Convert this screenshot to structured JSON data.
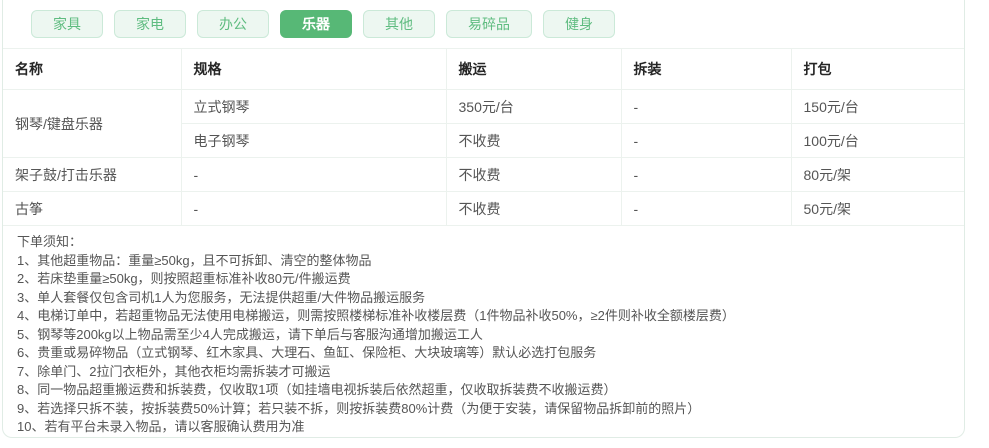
{
  "tabs": [
    {
      "label": "家具",
      "active": false
    },
    {
      "label": "家电",
      "active": false
    },
    {
      "label": "办公",
      "active": false
    },
    {
      "label": "乐器",
      "active": true
    },
    {
      "label": "其他",
      "active": false
    },
    {
      "label": "易碎品",
      "active": false
    },
    {
      "label": "健身",
      "active": false
    }
  ],
  "table": {
    "headers": [
      "名称",
      "规格",
      "搬运",
      "拆装",
      "打包"
    ],
    "groups": [
      {
        "name": "钢琴/键盘乐器",
        "rows": [
          {
            "spec": "立式钢琴",
            "moving": "350元/台",
            "disassembly": "-",
            "packing": "150元/台"
          },
          {
            "spec": "电子钢琴",
            "moving": "不收费",
            "disassembly": "-",
            "packing": "100元/台"
          }
        ]
      },
      {
        "name": "架子鼓/打击乐器",
        "rows": [
          {
            "spec": "-",
            "moving": "不收费",
            "disassembly": "-",
            "packing": "80元/架"
          }
        ]
      },
      {
        "name": "古筝",
        "rows": [
          {
            "spec": "-",
            "moving": "不收费",
            "disassembly": "-",
            "packing": "50元/架"
          }
        ]
      }
    ]
  },
  "notes": {
    "title": "下单须知：",
    "items": [
      "1、其他超重物品：重量≥50kg，且不可拆卸、清空的整体物品",
      "2、若床垫重量≥50kg，则按照超重标准补收80元/件搬运费",
      "3、单人套餐仅包含司机1人为您服务，无法提供超重/大件物品搬运服务",
      "4、电梯订单中，若超重物品无法使用电梯搬运，则需按照楼梯标准补收楼层费（1件物品补收50%，≥2件则补收全额楼层费）",
      "5、钢琴等200kg以上物品需至少4人完成搬运，请下单后与客服沟通增加搬运工人",
      "6、贵重或易碎物品（立式钢琴、红木家具、大理石、鱼缸、保险柜、大块玻璃等）默认必选打包服务",
      "7、除单门、2拉门衣柜外，其他衣柜均需拆装才可搬运",
      "8、同一物品超重搬运费和拆装费，仅收取1项（如挂墙电视拆装后依然超重，仅收取拆装费不收搬运费）",
      "9、若选择只拆不装，按拆装费50%计算；若只装不拆，则按拆装费80%计费（为便于安装，请保留物品拆卸前的照片）",
      "10、若有平台未录入物品，请以客服确认费用为准"
    ]
  },
  "colors": {
    "accent": "#57b876",
    "tab_bg": "#edf7f1",
    "tab_border": "#cbe9d8",
    "tab_text": "#5fbc80",
    "table_line": "#ecf2ee",
    "card_border": "#e0ece5",
    "header_text": "#262626",
    "body_text": "#555555"
  }
}
